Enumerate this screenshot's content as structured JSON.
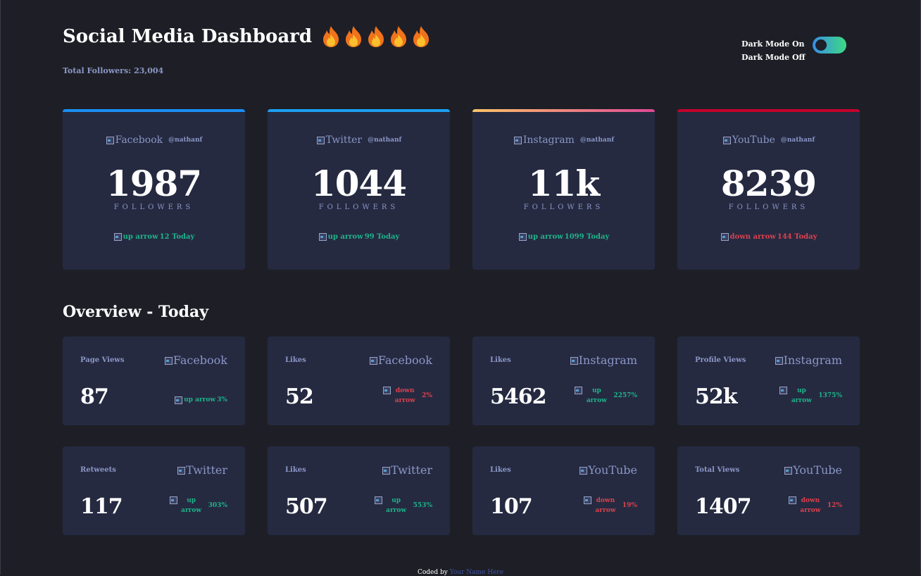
{
  "header": {
    "title": "Social Media Dashboard",
    "flame_count": 5,
    "total_followers": "Total Followers: 23,004"
  },
  "theme_toggle": {
    "on_label": "Dark Mode On",
    "off_label": "Dark Mode Off",
    "state": "on"
  },
  "colors": {
    "background": "#1e1f26",
    "card": "#252a41",
    "facebook": "#198ff5",
    "twitter": "#1ca0f2",
    "instagram_start": "#fdc468",
    "instagram_end": "#df4996",
    "youtube": "#c4032b",
    "up": "#1db489",
    "down": "#dc414c",
    "muted": "#8b97c6"
  },
  "cards": [
    {
      "platform": "Facebook",
      "handle": "@nathanf",
      "followers": "1987",
      "label": "FOLLOWERS",
      "change_alt": "up arrow",
      "change_text": "12 Today",
      "trend": "up"
    },
    {
      "platform": "Twitter",
      "handle": "@nathanf",
      "followers": "1044",
      "label": "FOLLOWERS",
      "change_alt": "up arrow",
      "change_text": "99 Today",
      "trend": "up"
    },
    {
      "platform": "Instagram",
      "handle": "@nathanf",
      "followers": "11k",
      "label": "FOLLOWERS",
      "change_alt": "up arrow",
      "change_text": "1099 Today",
      "trend": "up"
    },
    {
      "platform": "YouTube",
      "handle": "@nathanf",
      "followers": "8239",
      "label": "FOLLOWERS",
      "change_alt": "down arrow",
      "change_text": "144 Today",
      "trend": "down"
    }
  ],
  "overview": {
    "title": "Overview - Today",
    "items": [
      {
        "label": "Page Views",
        "icon_alt": "Facebook",
        "value": "87",
        "arrow_alt": "up arrow",
        "percent": "3%",
        "trend": "up"
      },
      {
        "label": "Likes",
        "icon_alt": "Facebook",
        "value": "52",
        "arrow_alt": "down arrow",
        "percent": "2%",
        "trend": "down"
      },
      {
        "label": "Likes",
        "icon_alt": "Instagram",
        "value": "5462",
        "arrow_alt": "up arrow",
        "percent": "2257%",
        "trend": "up"
      },
      {
        "label": "Profile Views",
        "icon_alt": "Instagram",
        "value": "52k",
        "arrow_alt": "up arrow",
        "percent": "1375%",
        "trend": "up"
      },
      {
        "label": "Retweets",
        "icon_alt": "Twitter",
        "value": "117",
        "arrow_alt": "up arrow",
        "percent": "303%",
        "trend": "up"
      },
      {
        "label": "Likes",
        "icon_alt": "Twitter",
        "value": "507",
        "arrow_alt": "up arrow",
        "percent": "553%",
        "trend": "up"
      },
      {
        "label": "Likes",
        "icon_alt": "YouTube",
        "value": "107",
        "arrow_alt": "down arrow",
        "percent": "19%",
        "trend": "down"
      },
      {
        "label": "Total Views",
        "icon_alt": "YouTube",
        "value": "1407",
        "arrow_alt": "down arrow",
        "percent": "12%",
        "trend": "down"
      }
    ]
  },
  "footer": {
    "prefix": "Coded by",
    "author": "Your Name Here"
  }
}
